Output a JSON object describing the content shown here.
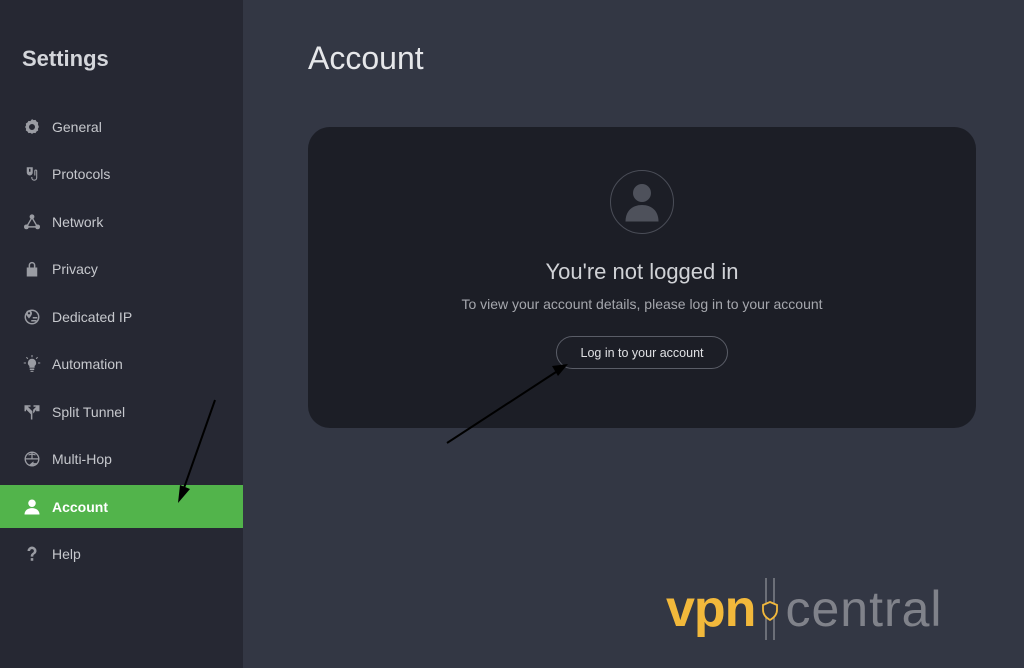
{
  "sidebar": {
    "title": "Settings",
    "items": [
      {
        "label": "General",
        "icon": "gear-icon",
        "active": false
      },
      {
        "label": "Protocols",
        "icon": "protocols-icon",
        "active": false
      },
      {
        "label": "Network",
        "icon": "network-icon",
        "active": false
      },
      {
        "label": "Privacy",
        "icon": "lock-icon",
        "active": false
      },
      {
        "label": "Dedicated IP",
        "icon": "globe-pin-icon",
        "active": false
      },
      {
        "label": "Automation",
        "icon": "lightbulb-icon",
        "active": false
      },
      {
        "label": "Split Tunnel",
        "icon": "split-arrows-icon",
        "active": false
      },
      {
        "label": "Multi-Hop",
        "icon": "globe-arrow-icon",
        "active": false
      },
      {
        "label": "Account",
        "icon": "user-icon",
        "active": true
      },
      {
        "label": "Help",
        "icon": "question-icon",
        "active": false
      }
    ]
  },
  "main": {
    "title": "Account",
    "card": {
      "heading": "You're not logged in",
      "subtext": "To view your account details, please log in to your account",
      "login_button": "Log in to your account"
    }
  },
  "watermark": {
    "brand_part1": "vpn",
    "brand_part2": "central"
  },
  "colors": {
    "accent": "#52b44b",
    "sidebar_bg": "#262833",
    "main_bg": "#333744",
    "card_bg": "#1c1e26",
    "brand_yellow": "#f2b83b"
  }
}
